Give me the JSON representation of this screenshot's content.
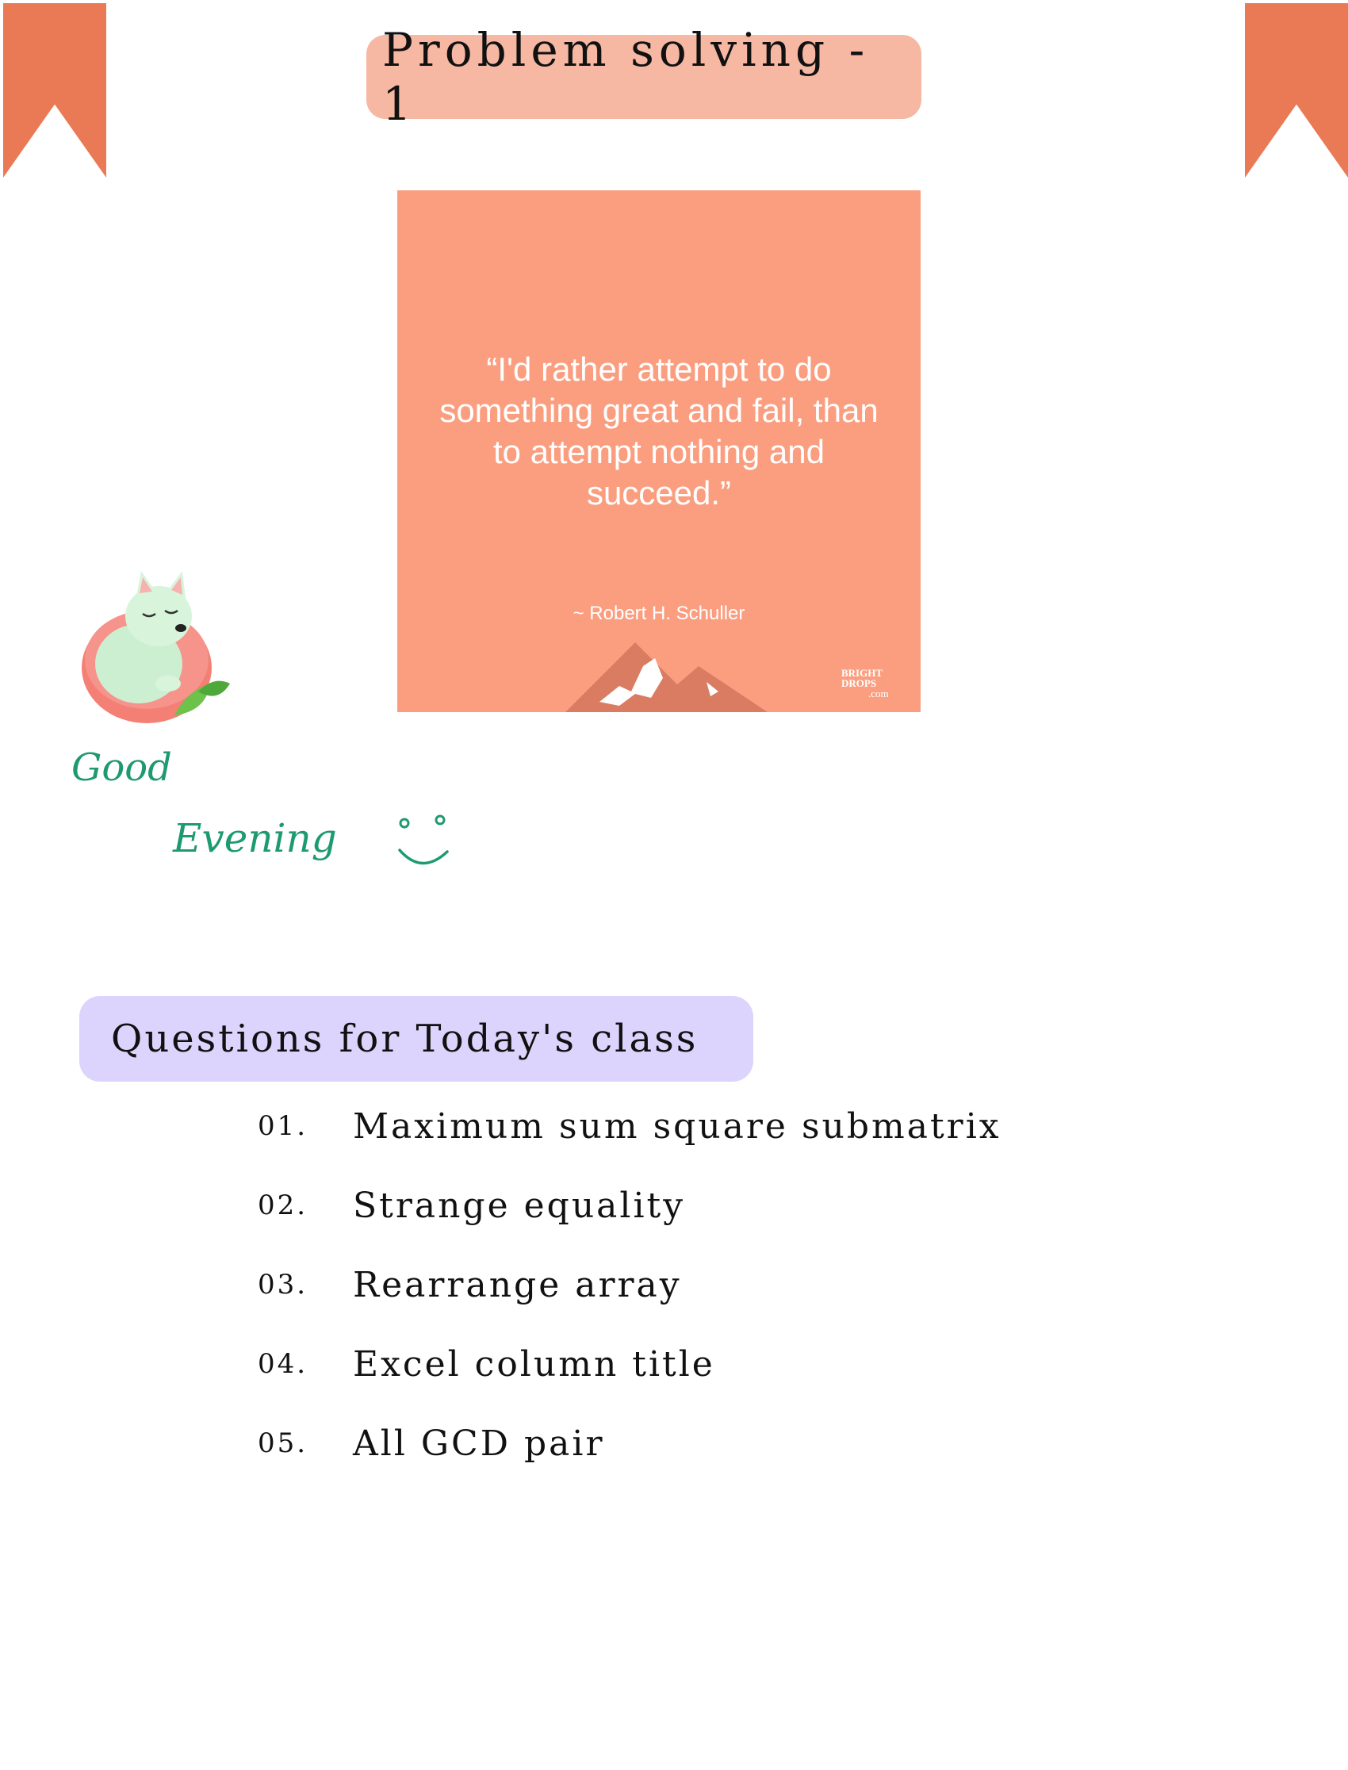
{
  "header": {
    "title": "Problem solving - 1"
  },
  "quote": {
    "text": "“I'd rather attempt to do something great and fail, than to attempt nothing and succeed.”",
    "author": "~ Robert H. Schuller",
    "brand_line1": "BRIGHT",
    "brand_line2": "DROPS",
    "brand_line3": ".com"
  },
  "greeting": {
    "line1": "Good",
    "line2": "Evening"
  },
  "section": {
    "title": "Questions for Today's class"
  },
  "questions": [
    {
      "num": "01.",
      "title": "Maximum sum square submatrix"
    },
    {
      "num": "02.",
      "title": "Strange equality"
    },
    {
      "num": "03.",
      "title": "Rearrange array"
    },
    {
      "num": "04.",
      "title": "Excel column title"
    },
    {
      "num": "05.",
      "title": "All GCD pair"
    }
  ],
  "colors": {
    "ribbon": "#ea7a55",
    "title_highlight": "#f6b7a3",
    "quote_background": "#fb9e80",
    "greeting_text": "#1e9a6f",
    "section_highlight": "#dcd4fd"
  },
  "icons": [
    "bookmark-ribbon-icon",
    "mountain-icon",
    "sleeping-dog-sticker",
    "smiley-icon"
  ]
}
